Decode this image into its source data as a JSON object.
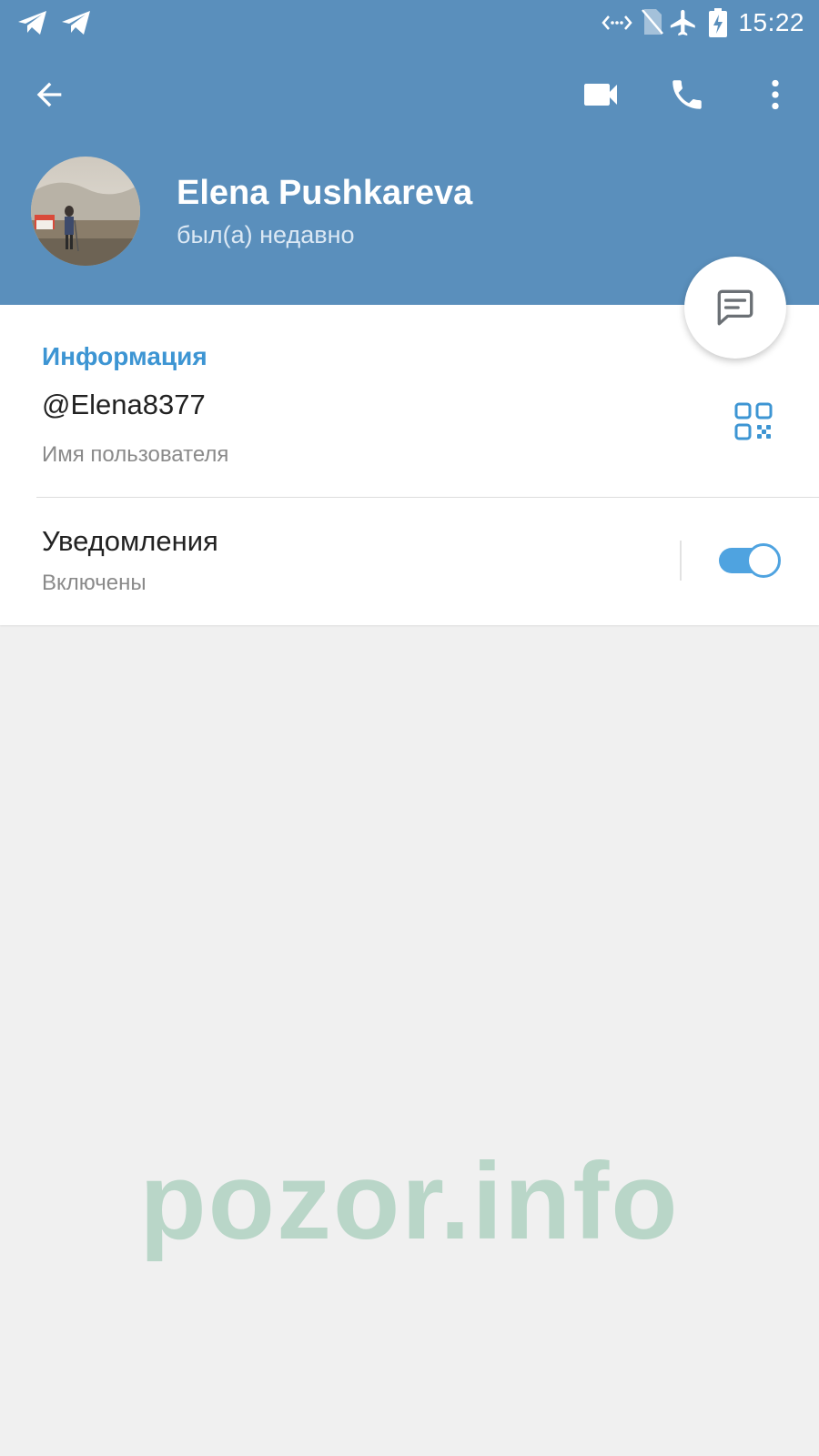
{
  "status_bar": {
    "time": "15:22",
    "icons": [
      "telegram-notification-icon",
      "telegram-notification-icon",
      "data-transfer-icon",
      "no-sim-icon",
      "airplane-mode-icon",
      "battery-charging-icon"
    ]
  },
  "toolbar": {
    "back_icon": "arrow-left-icon",
    "video_call_icon": "video-camera-icon",
    "call_icon": "phone-icon",
    "menu_icon": "more-vert-icon"
  },
  "profile": {
    "name": "Elena Pushkareva",
    "status": "был(а) недавно",
    "avatar": "profile-photo"
  },
  "fab": {
    "icon": "message-icon"
  },
  "info": {
    "section_title": "Информация",
    "username": {
      "value": "@Elena8377",
      "label": "Имя пользователя",
      "qr_icon": "qr-code-icon"
    },
    "notifications": {
      "title": "Уведомления",
      "status": "Включены",
      "enabled": true
    }
  },
  "watermark": "pozor.info",
  "colors": {
    "header": "#5a8fbc",
    "accent": "#3d95d3",
    "toggle_on": "#4fa3e0",
    "background": "#f0f0f0",
    "watermark": "#b9d6c8"
  }
}
